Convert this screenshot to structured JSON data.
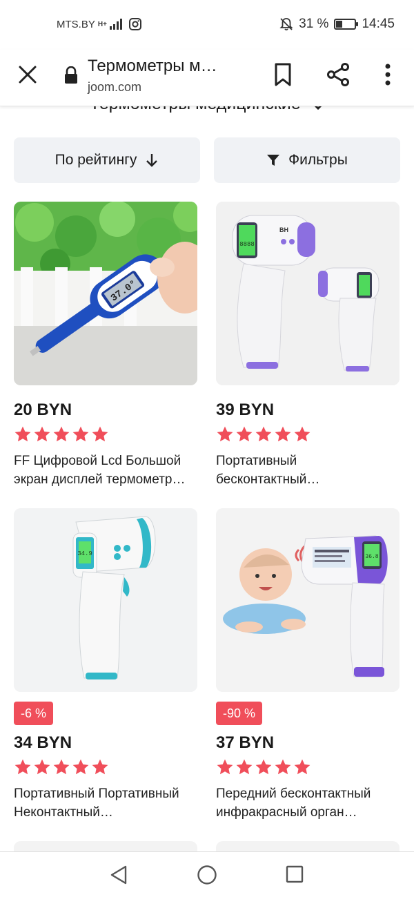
{
  "status": {
    "carrier": "MTS.BY",
    "network": "H+",
    "battery_text": "31 %",
    "battery_level": 0.31,
    "time": "14:45"
  },
  "browser": {
    "title": "Термометры м…",
    "url": "joom.com"
  },
  "category": {
    "label": "Термометры медицинские"
  },
  "toolbar": {
    "sort_label": "По рейтингу",
    "filter_label": "Фильтры"
  },
  "products": [
    {
      "price": "20 BYN",
      "rating": 5,
      "badge": "",
      "title": "FF Цифровой Lcd Большой экран дисплей термометр…"
    },
    {
      "price": "39 BYN",
      "rating": 5,
      "badge": "",
      "title": "Портативный бесконтактный…"
    },
    {
      "price": "34 BYN",
      "rating": 5,
      "badge": "-6 %",
      "title": "Портативный Портативный Неконтактный…"
    },
    {
      "price": "37 BYN",
      "rating": 5,
      "badge": "-90 %",
      "title": "Передний бесконтактный инфракрасный орган…"
    }
  ],
  "thermo_display": {
    "p1": "37.0°",
    "p2": "8888",
    "p3": "34.9",
    "p4": "36.8",
    "brand": "BH"
  },
  "colors": {
    "accent": "#f04e5a",
    "star": "#f04e5a",
    "chip_bg": "#f0f2f5"
  }
}
